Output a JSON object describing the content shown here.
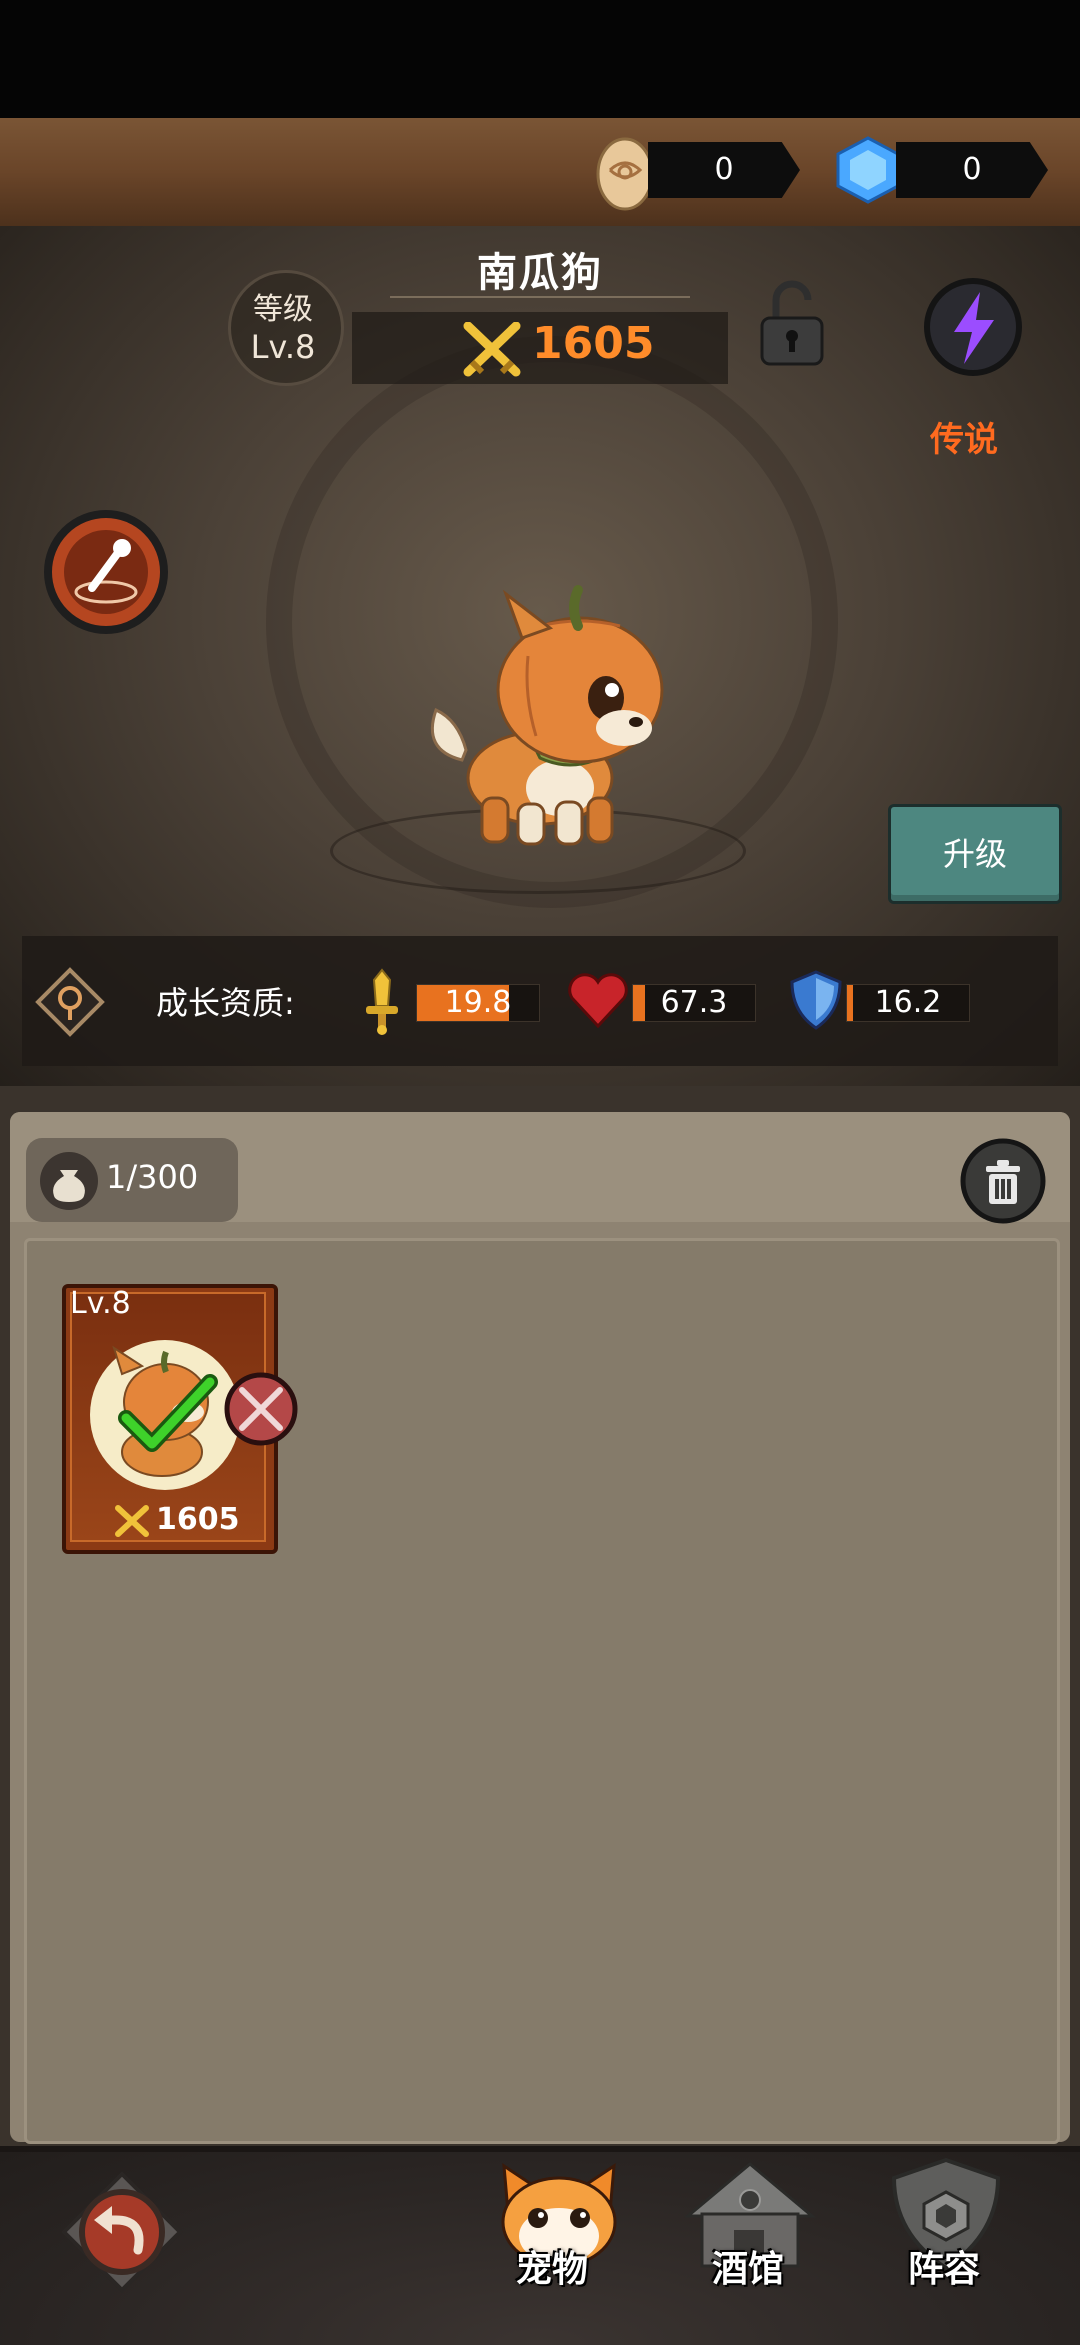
{
  "currency": {
    "eggs": {
      "icon": "golden-egg-icon",
      "value": "0"
    },
    "gems": {
      "icon": "blue-gem-icon",
      "value": "0"
    }
  },
  "pet": {
    "name": "南瓜狗",
    "level_label": "等级",
    "level_value": "Lv.8",
    "power": "1605",
    "rarity": "传说",
    "upgrade_label": "升级"
  },
  "growth": {
    "label": "成长资质:",
    "stats": [
      {
        "icon": "sword-icon",
        "value": "19.8",
        "fill": 0.75
      },
      {
        "icon": "heart-icon",
        "value": "67.3",
        "fill": 0.1
      },
      {
        "icon": "shield-icon",
        "value": "16.2",
        "fill": 0.05
      }
    ]
  },
  "inventory": {
    "capacity": "1/300",
    "cards": [
      {
        "level": "Lv.8",
        "power": "1605",
        "equipped": true
      }
    ]
  },
  "nav": {
    "tabs": [
      {
        "label": "宠物",
        "icon": "cat-icon"
      },
      {
        "label": "酒馆",
        "icon": "tavern-icon"
      },
      {
        "label": "阵容",
        "icon": "shield-lineup-icon"
      }
    ]
  },
  "colors": {
    "accent_orange": "#ff8c2a",
    "rarity": "#ff6a1f",
    "upgrade_button": "#4d8780",
    "stat_fill": "#e8721f"
  }
}
